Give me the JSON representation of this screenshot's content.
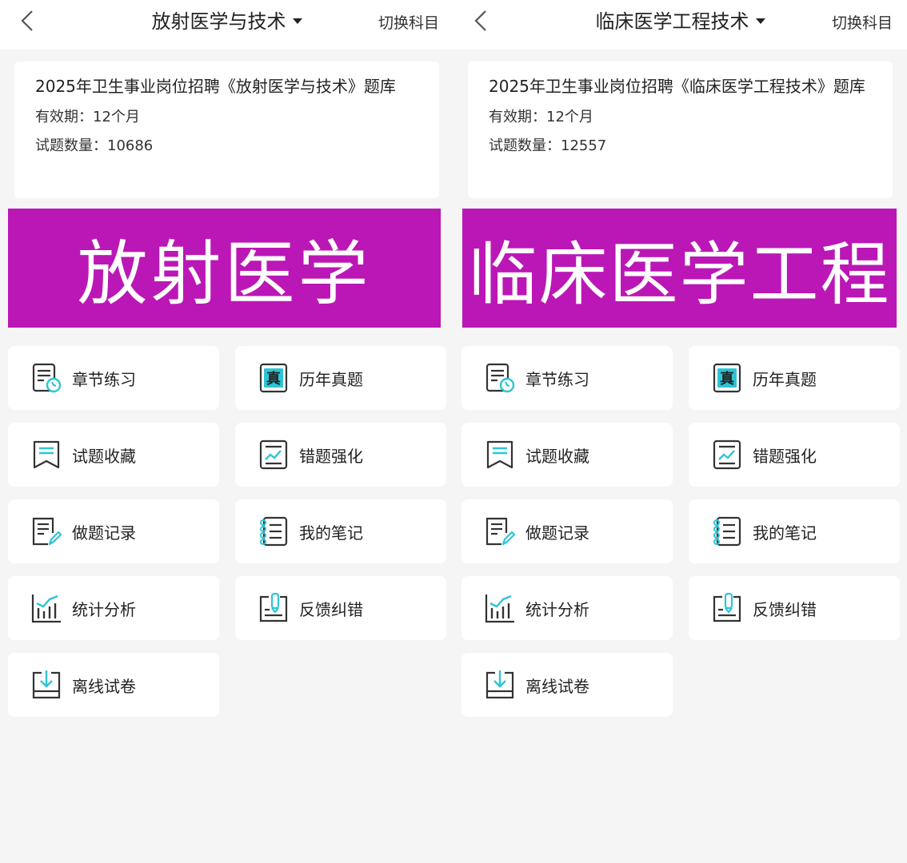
{
  "panels": [
    {
      "title": "放射医学与技术",
      "switch_label": "切换科目",
      "info": {
        "title": "2025年卫生事业岗位招聘《放射医学与技术》题库",
        "validity": "有效期：12个月",
        "count": "试题数量：10686"
      },
      "banner": "放射医学",
      "menu": [
        {
          "label": "章节练习",
          "icon": "chapter-practice-icon"
        },
        {
          "label": "历年真题",
          "icon": "past-papers-icon"
        },
        {
          "label": "试题收藏",
          "icon": "favorites-icon"
        },
        {
          "label": "错题强化",
          "icon": "wrong-questions-icon"
        },
        {
          "label": "做题记录",
          "icon": "history-record-icon"
        },
        {
          "label": "我的笔记",
          "icon": "notes-icon"
        },
        {
          "label": "统计分析",
          "icon": "statistics-icon"
        },
        {
          "label": "反馈纠错",
          "icon": "feedback-icon"
        },
        {
          "label": "离线试卷",
          "icon": "offline-download-icon"
        }
      ]
    },
    {
      "title": "临床医学工程技术",
      "switch_label": "切换科目",
      "info": {
        "title": "2025年卫生事业岗位招聘《临床医学工程技术》题库",
        "validity": "有效期：12个月",
        "count": "试题数量：12557"
      },
      "banner": "临床医学工程",
      "menu": [
        {
          "label": "章节练习",
          "icon": "chapter-practice-icon"
        },
        {
          "label": "历年真题",
          "icon": "past-papers-icon"
        },
        {
          "label": "试题收藏",
          "icon": "favorites-icon"
        },
        {
          "label": "错题强化",
          "icon": "wrong-questions-icon"
        },
        {
          "label": "做题记录",
          "icon": "history-record-icon"
        },
        {
          "label": "我的笔记",
          "icon": "notes-icon"
        },
        {
          "label": "统计分析",
          "icon": "statistics-icon"
        },
        {
          "label": "反馈纠错",
          "icon": "feedback-icon"
        },
        {
          "label": "离线试卷",
          "icon": "offline-download-icon"
        }
      ]
    }
  ],
  "colors": {
    "banner": "#bb17b6",
    "icon_dark": "#333333",
    "icon_accent": "#2ec4d6",
    "background": "#f5f5f5"
  }
}
